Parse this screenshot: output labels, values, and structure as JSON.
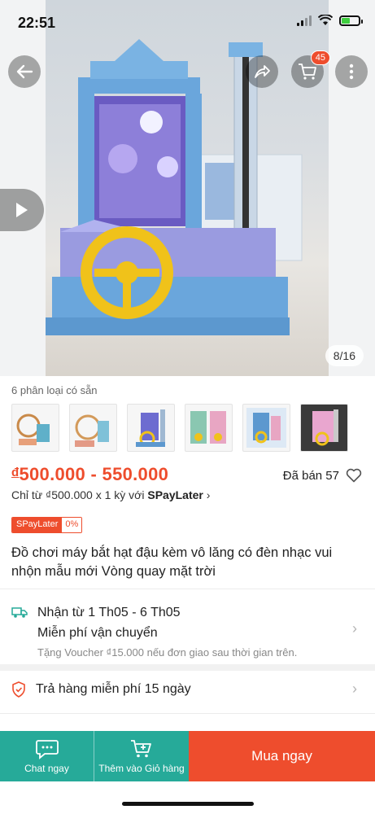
{
  "status_bar": {
    "time": "22:51"
  },
  "header": {
    "cart_count": "45"
  },
  "gallery": {
    "counter": "8/16"
  },
  "variants": {
    "label": "6 phân loại có sẵn",
    "count": 6
  },
  "product": {
    "price_currency": "đ",
    "price_range": "500.000 - 550.000",
    "sold_label": "Đã bán 57",
    "paylater_text": "Chỉ từ ₫500.000 x 1 kỳ với",
    "paylater_brand": "SPayLater",
    "spaylater_badge": "SPayLater",
    "spaylater_rate": "0%",
    "title": "Đồ chơi máy bắt hạt đậu kèm vô lăng có đèn nhạc vui nhộn mẫu mới Vòng quay mặt trời"
  },
  "shipping": {
    "delivery": "Nhận từ 1 Th05 - 6 Th05",
    "free_ship": "Miễn phí vận chuyển",
    "voucher": "Tặng Voucher ₫15.000 nếu đơn giao sau thời gian trên."
  },
  "returns": {
    "label": "Trả hàng miễn phí 15 ngày"
  },
  "bottom_bar": {
    "chat_label": "Chat ngay",
    "cart_label": "Thêm vào Giỏ hàng",
    "buy_label": "Mua ngay"
  },
  "colors": {
    "brand": "#ee4d2d",
    "teal": "#26aa99"
  }
}
